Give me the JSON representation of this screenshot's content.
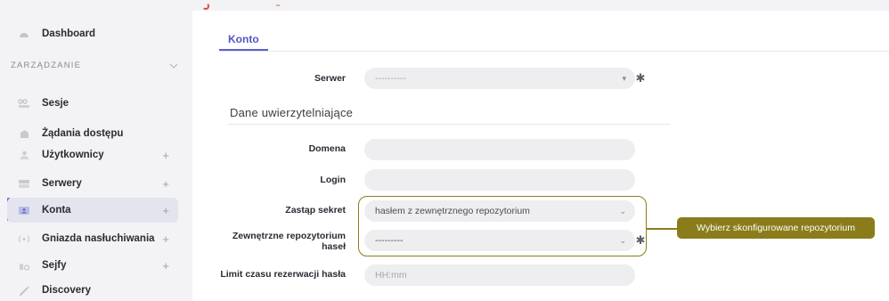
{
  "sidebar": {
    "items_top": [
      {
        "label": "Dashboard",
        "icon": "dashboard-icon"
      }
    ],
    "section": {
      "label": "ZARZĄDZANIE"
    },
    "items": [
      {
        "label": "Sesje",
        "icon": "sessions-icon",
        "expandable": false
      },
      {
        "label": "Żądania dostępu",
        "icon": "access-requests-icon",
        "expandable": false
      },
      {
        "label": "Użytkownicy",
        "icon": "users-icon",
        "expandable": true
      },
      {
        "label": "Serwery",
        "icon": "servers-icon",
        "expandable": true
      },
      {
        "label": "Konta",
        "icon": "accounts-icon",
        "expandable": true,
        "active": true
      },
      {
        "label": "Gniazda nasłuchiwania",
        "icon": "listeners-icon",
        "expandable": true
      },
      {
        "label": "Sejfy",
        "icon": "safes-icon",
        "expandable": true
      },
      {
        "label": "Discovery",
        "icon": "discovery-icon",
        "expandable": false
      }
    ],
    "plus_symbol": "+"
  },
  "main": {
    "tab": {
      "label": "Konto"
    },
    "server": {
      "label": "Serwer",
      "value": "----------",
      "required_mark": "✱"
    },
    "credentials_title": "Dane uwierzytelniające",
    "domain": {
      "label": "Domena",
      "value": ""
    },
    "login": {
      "label": "Login",
      "value": ""
    },
    "replace_secret": {
      "label": "Zastąp sekret",
      "value": "hasłem z zewnętrznego repozytorium"
    },
    "external_repo": {
      "label_line1": "Zewnętrzne repozytorium",
      "label_line2": "haseł",
      "value": "---------",
      "required_mark": "✱"
    },
    "reservation_limit": {
      "label": "Limit czasu rezerwacji hasła",
      "placeholder": "HH:mm"
    }
  },
  "callout": {
    "text": "Wybierz skonfigurowane repozytorium"
  },
  "colors": {
    "accent": "#5a60cc",
    "callout": "#8a7c1a",
    "active_bg": "#e4e4ef"
  }
}
